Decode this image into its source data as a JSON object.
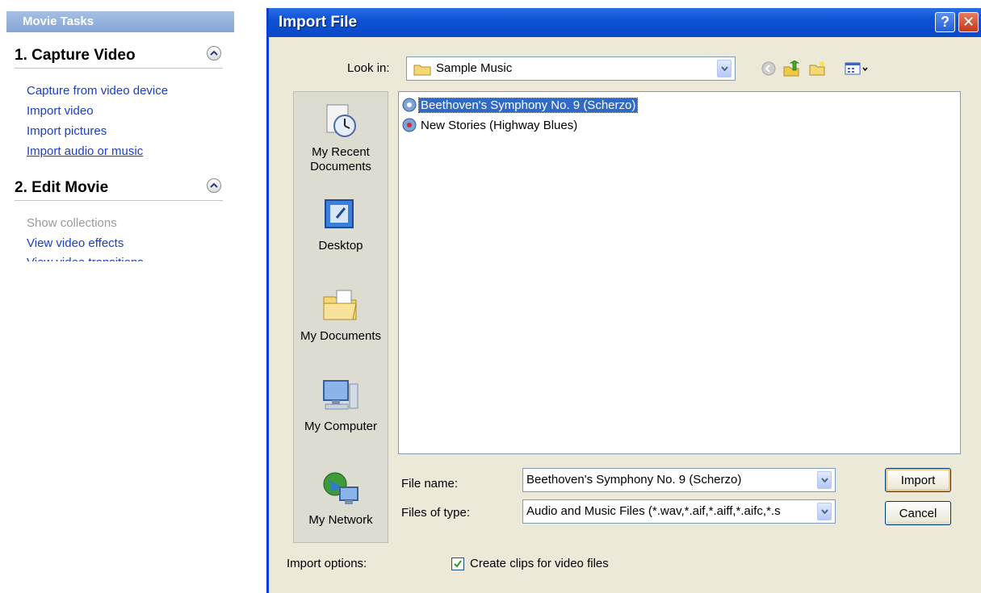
{
  "taskpane": {
    "title": "Movie Tasks",
    "section1": {
      "title": "1. Capture Video",
      "tasks": [
        "Capture from video device",
        "Import video",
        "Import pictures",
        "Import audio or music"
      ]
    },
    "section2": {
      "title": "2. Edit Movie",
      "tasks": [
        "Show collections",
        "View video effects",
        "View video transitions"
      ]
    }
  },
  "dialog": {
    "title": "Import File",
    "help_glyph": "?",
    "close_glyph": "✕",
    "look_in_label": "Look in:",
    "look_in_value": "Sample Music",
    "places": [
      "My Recent Documents",
      "Desktop",
      "My Documents",
      "My Computer",
      "My Network"
    ],
    "files": [
      "Beethoven's Symphony No. 9 (Scherzo)",
      "New Stories (Highway Blues)"
    ],
    "selected_file_index": 0,
    "file_name_label": "File name:",
    "file_name_value": "Beethoven's Symphony No. 9 (Scherzo)",
    "files_of_type_label": "Files of type:",
    "files_of_type_value": "Audio and Music Files (*.wav,*.aif,*.aiff,*.aifc,*.s",
    "import_button": "Import",
    "cancel_button": "Cancel",
    "import_options_label": "Import options:",
    "create_clips_label": "Create clips for video files",
    "create_clips_checked": true
  },
  "colors": {
    "titlebar": "#0a48c6",
    "link": "#1b3fbf",
    "selection": "#316ac5",
    "dialog_bg": "#ece9d8"
  },
  "icons": [
    "collapse-up-icon",
    "folder-icon",
    "back-icon",
    "up-folder-icon",
    "new-folder-icon",
    "views-icon",
    "audio-file-icon",
    "recent-documents-icon",
    "desktop-icon",
    "my-documents-icon",
    "my-computer-icon",
    "my-network-icon",
    "checkmark-icon"
  ]
}
